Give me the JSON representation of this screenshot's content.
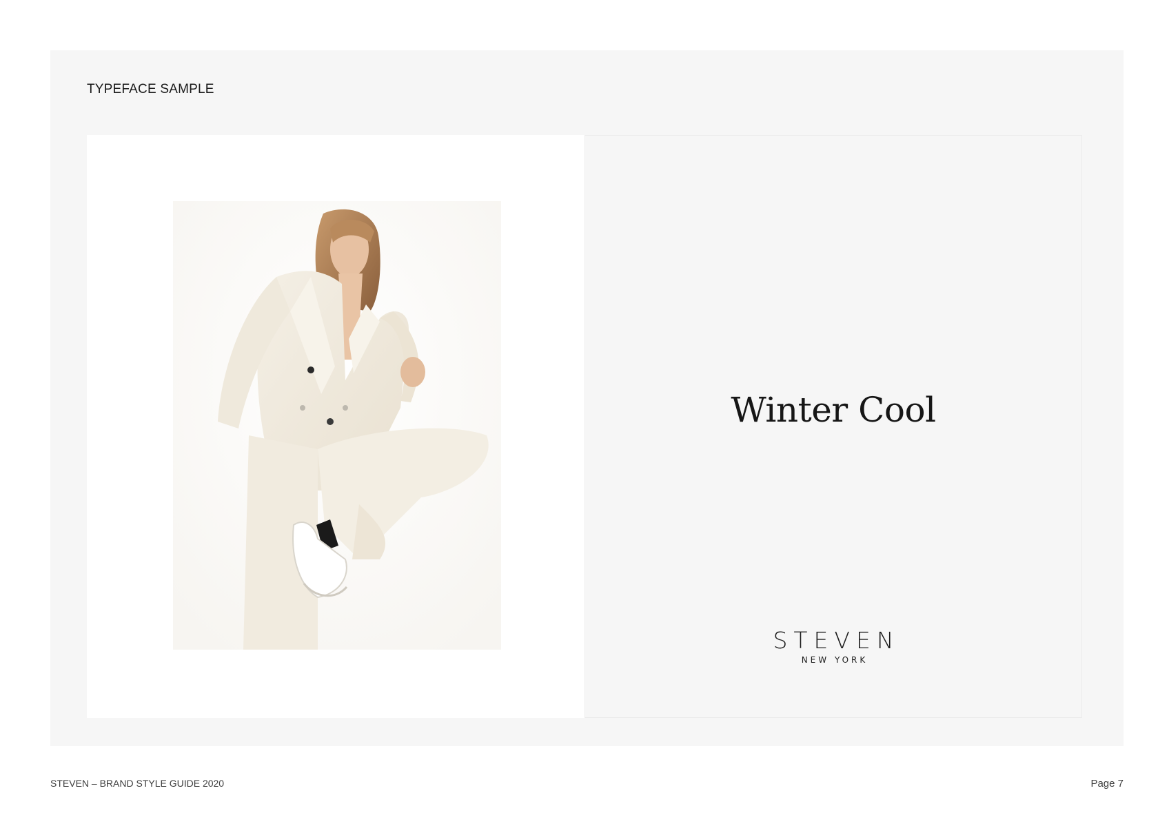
{
  "section": {
    "title": "TYPEFACE SAMPLE"
  },
  "sample": {
    "text": "Winter Cool",
    "image": {
      "subject": "model in white oversized suit and white sneakers"
    }
  },
  "logo": {
    "wordmark": "STEVEN",
    "subline": "NEW YORK"
  },
  "footer": {
    "document_title": "STEVEN – BRAND STYLE GUIDE 2020",
    "page_label": "Page 7"
  },
  "colors": {
    "panel_background": "#f6f6f6",
    "text": "#161616",
    "footer_text": "#3c3c3c"
  }
}
